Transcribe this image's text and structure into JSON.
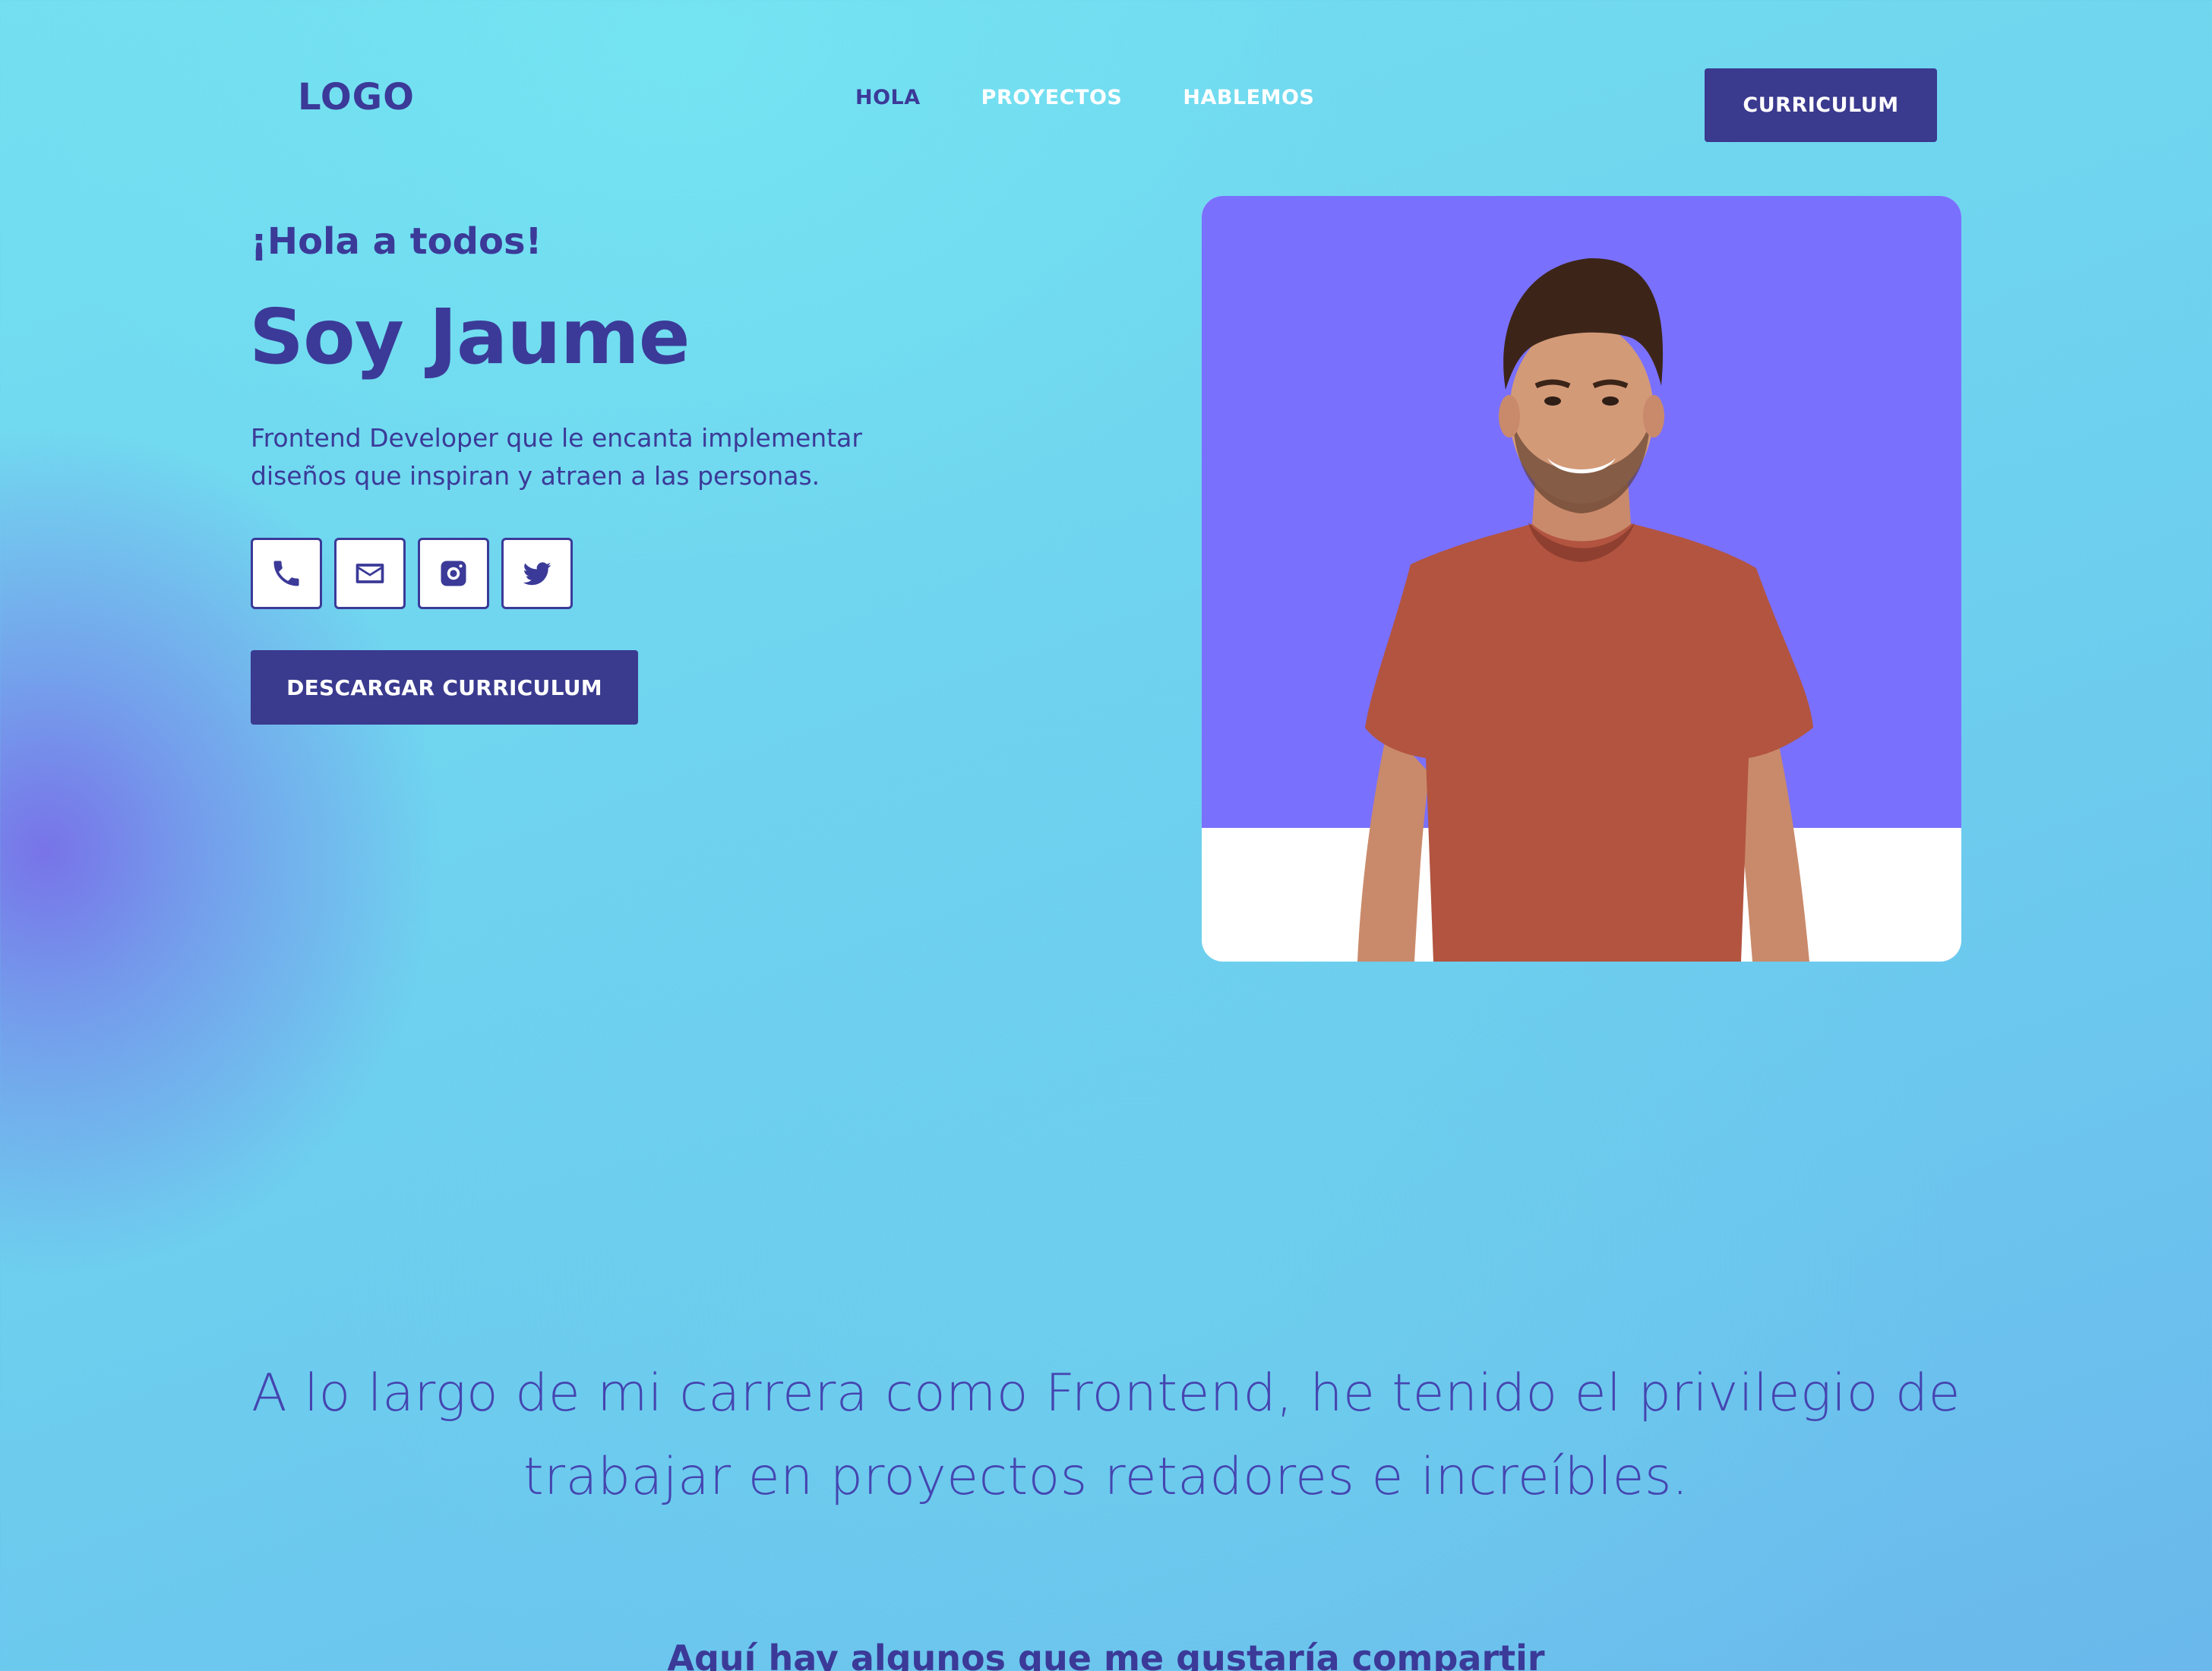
{
  "brand": {
    "logo_text": "LOGO"
  },
  "nav": {
    "items": [
      {
        "label": "HOLA",
        "active": true
      },
      {
        "label": "PROYECTOS",
        "active": false
      },
      {
        "label": "HABLEMOS",
        "active": false
      }
    ],
    "cta_label": "CURRICULUM"
  },
  "hero": {
    "greeting": "¡Hola a todos!",
    "name": "Soy Jaume",
    "description": "Frontend Developer que le encanta implementar diseños que inspiran y atraen a las personas.",
    "socials": [
      {
        "icon": "phone-icon"
      },
      {
        "icon": "mail-icon"
      },
      {
        "icon": "instagram-icon"
      },
      {
        "icon": "twitter-icon"
      }
    ],
    "download_label": "DESCARGAR CURRICULUM"
  },
  "about": {
    "text": "A lo largo de mi carrera como Frontend, he tenido el privilegio de trabajar en proyectos retadores e increíbles.",
    "share_heading": "Aquí hay algunos que me gustaría compartir"
  },
  "colors": {
    "primary": "#3a3a8f",
    "accent_text": "#3b3a98",
    "photo_background": "#7a70fe",
    "gradient_cyan": "#73dff0",
    "gradient_violet": "#786ee8"
  }
}
